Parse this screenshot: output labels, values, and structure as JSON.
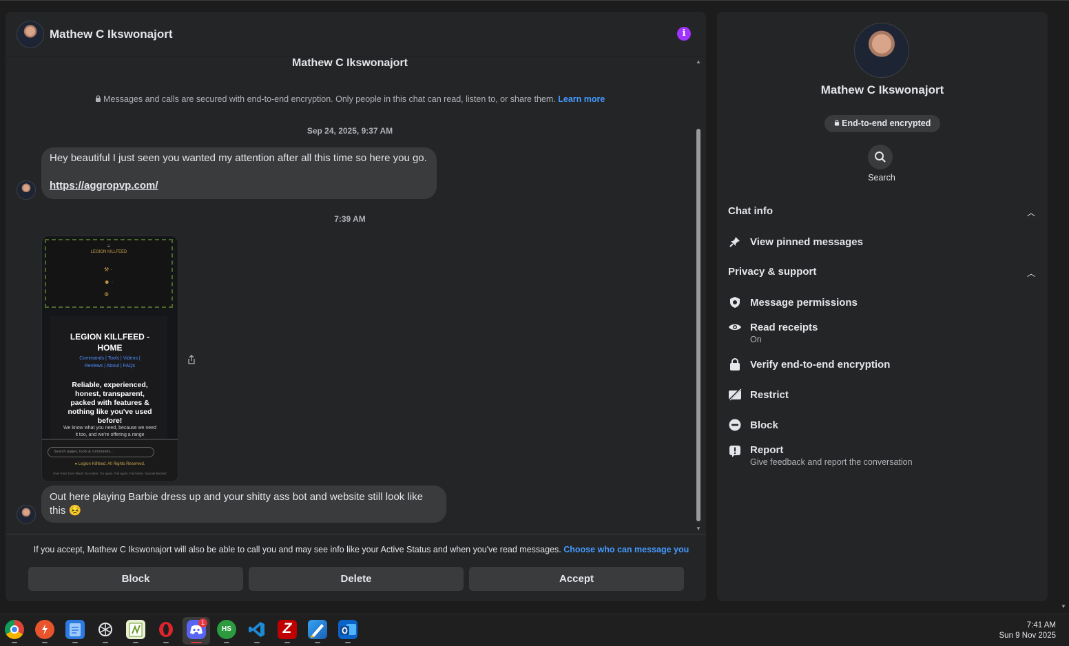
{
  "chat": {
    "contact_name": "Mathew C Ikswonajort",
    "info_icon": "info-icon",
    "conversation_title": "Mathew C Ikswonajort",
    "encryption_notice": "Messages and calls are secured with end-to-end encryption. Only people in this chat can read, listen to, or share them.",
    "learn_more": "Learn more",
    "timestamp_1": "Sep 24, 2025, 9:37 AM",
    "message_1_text": "Hey beautiful I just seen you wanted my attention after all this time so here you go.",
    "message_1_link": "https://aggropvp.com/",
    "timestamp_2": "7:39 AM",
    "attachment": {
      "site_header": "LEGION KILLFEED",
      "title_line1": "LEGION KILLFEED -",
      "title_line2": "HOME",
      "links_line1": "Commands | Tools | Videos |",
      "links_line2": "Reviews | About | FAQs",
      "description": "Reliable, experienced, honest, transparent, packed with features & nothing like you've used before!",
      "small_text": "We know what you need, because we need it too, and we're offering a range",
      "search_placeholder": "Search pages, tools & commands...",
      "copyright": "Legion Killfeed. All Rights Reserved.",
      "tagline": "Ever tried. Ever failed. No matter. Try again. Fail again. Fail better.",
      "signature": "Samuel Beckett"
    },
    "message_2_text": "Out here playing Barbie dress up and your shitty ass bot and website still look like this 😣",
    "accept_note": "If you accept, Mathew C Ikswonajort will also be able to call you and may see info like your Active Status and when you've read messages.",
    "choose_link": "Choose who can message you",
    "block_label": "Block",
    "delete_label": "Delete",
    "accept_label": "Accept"
  },
  "side": {
    "name": "Mathew C Ikswonajort",
    "encrypted_pill": "End-to-end encrypted",
    "search_label": "Search",
    "chat_info_heading": "Chat info",
    "pinned": "View pinned messages",
    "privacy_heading": "Privacy & support",
    "items": [
      {
        "label": "Message permissions",
        "sub": "",
        "icon": "shield-icon"
      },
      {
        "label": "Read receipts",
        "sub": "On",
        "icon": "eye-icon"
      },
      {
        "label": "Verify end-to-end encryption",
        "sub": "",
        "icon": "lock-icon"
      },
      {
        "label": "Restrict",
        "sub": "",
        "icon": "restrict-icon"
      },
      {
        "label": "Block",
        "sub": "",
        "icon": "block-icon"
      },
      {
        "label": "Report",
        "sub": "Give feedback and report the conversation",
        "icon": "report-icon"
      }
    ]
  },
  "taskbar": {
    "time": "7:41 AM",
    "date": "Sun 9 Nov 2025",
    "discord_badge": "1",
    "apps": [
      "chrome-icon",
      "app-2-icon",
      "notepad-icon",
      "chatgpt-icon",
      "notepadpp-icon",
      "opera-icon",
      "discord-icon",
      "hs-icon",
      "vscode-icon",
      "filezilla-icon",
      "paint-icon",
      "outlook-icon"
    ]
  },
  "colors": {
    "background": "#1c1c1d",
    "panel": "#242526",
    "bubble": "#3a3b3c",
    "link": "#4599ff",
    "info_accent": "#a033ff"
  }
}
